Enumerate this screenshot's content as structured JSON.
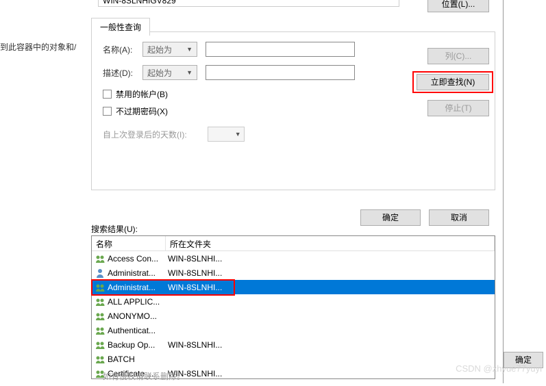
{
  "bg": {
    "left_text": "到此容器中的对象和/",
    "ok": "确定",
    "watermark": "CSDN @zhyue77yuyi",
    "bottom_hint": "如有侵权请联系删除。"
  },
  "location_value": "WIN-8SLNHIGV829",
  "buttons": {
    "location": "位置(L)...",
    "columns": "列(C)...",
    "find_now": "立即查找(N)",
    "stop": "停止(T)",
    "ok": "确定",
    "cancel": "取消"
  },
  "tab_label": "一般性查询",
  "fields": {
    "name_label": "名称(A):",
    "desc_label": "描述(D):",
    "starts_with": "起始为",
    "cb_disabled": "禁用的帐户(B)",
    "cb_noexpire": "不过期密码(X)",
    "days_label": "自上次登录后的天数(I):"
  },
  "results": {
    "label": "搜索结果(U):",
    "col_name": "名称",
    "col_folder": "所在文件夹",
    "rows": [
      {
        "name": "Access Con...",
        "folder": "WIN-8SLNHI...",
        "type": "group",
        "selected": false
      },
      {
        "name": "Administrat...",
        "folder": "WIN-8SLNHI...",
        "type": "user",
        "selected": false
      },
      {
        "name": "Administrat...",
        "folder": "WIN-8SLNHI...",
        "type": "group",
        "selected": true
      },
      {
        "name": "ALL APPLIC...",
        "folder": "",
        "type": "group",
        "selected": false
      },
      {
        "name": "ANONYMO...",
        "folder": "",
        "type": "group",
        "selected": false
      },
      {
        "name": "Authenticat...",
        "folder": "",
        "type": "group",
        "selected": false
      },
      {
        "name": "Backup Op...",
        "folder": "WIN-8SLNHI...",
        "type": "group",
        "selected": false
      },
      {
        "name": "BATCH",
        "folder": "",
        "type": "group",
        "selected": false
      },
      {
        "name": "Certificate ...",
        "folder": "WIN-8SLNHI...",
        "type": "group",
        "selected": false
      }
    ]
  }
}
